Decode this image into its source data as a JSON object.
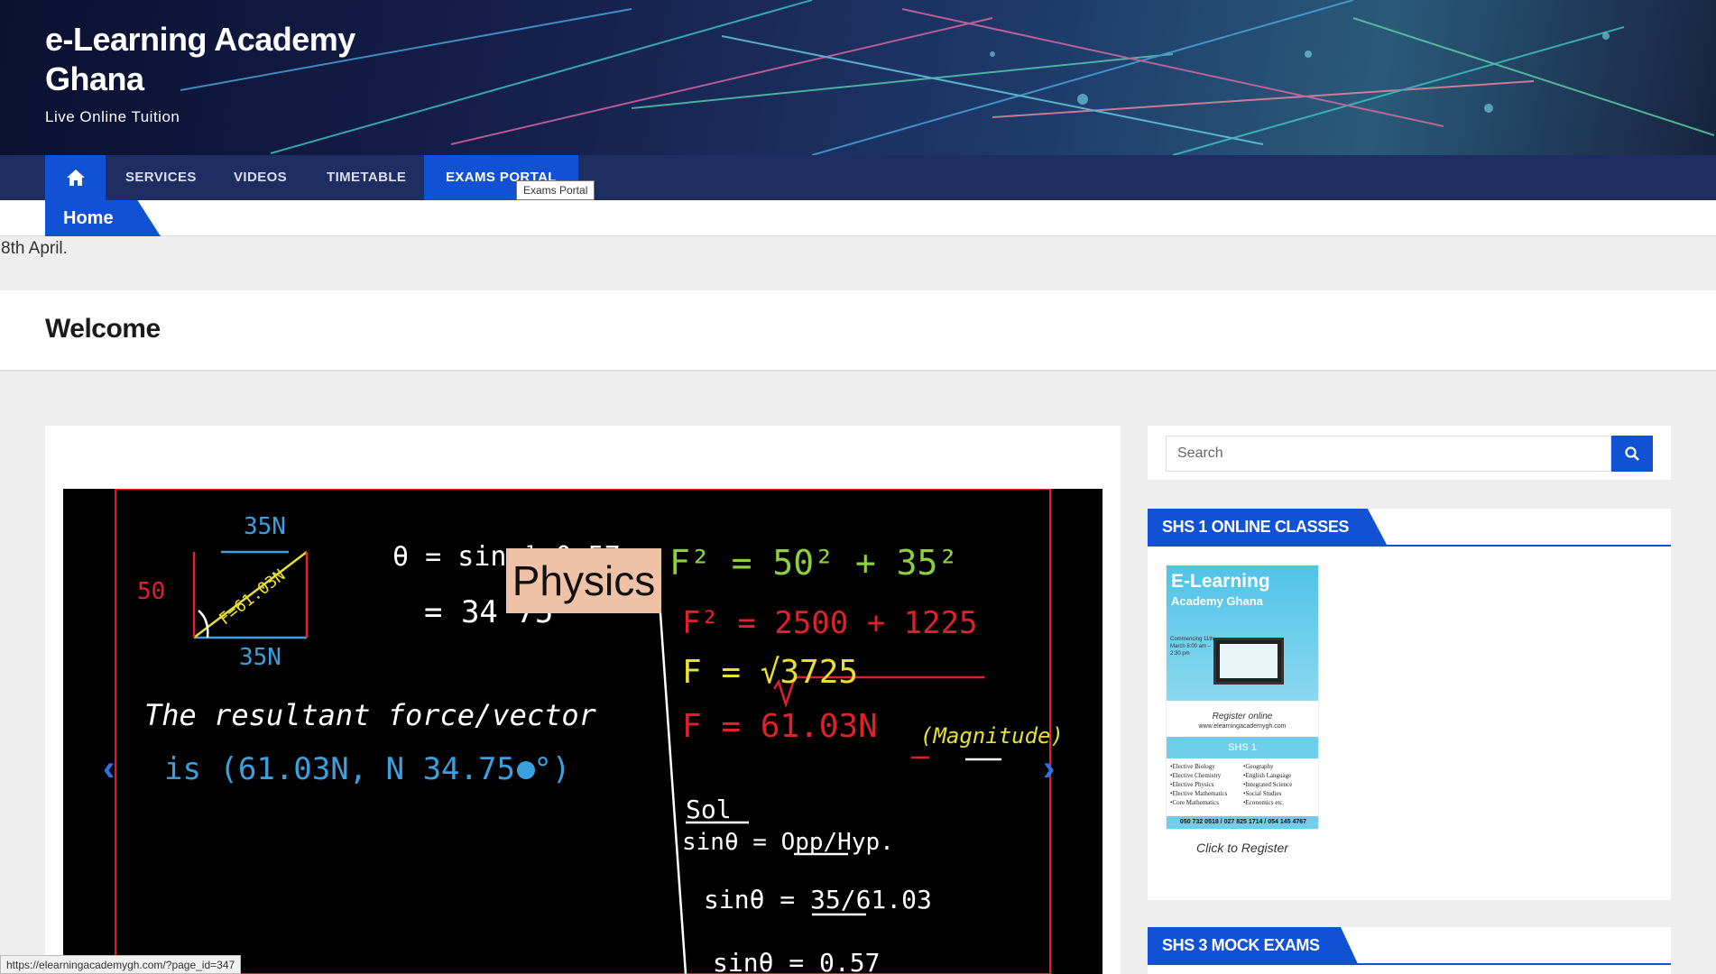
{
  "header": {
    "site_title": "e-Learning Academy Ghana",
    "tagline": "Live Online Tuition"
  },
  "nav": {
    "items": [
      {
        "label": "SERVICES"
      },
      {
        "label": "VIDEOS"
      },
      {
        "label": "TIMETABLE"
      },
      {
        "label": "EXAMS PORTAL"
      }
    ],
    "tooltip": "Exams Portal"
  },
  "breadcrumb": {
    "label": "Home"
  },
  "notice": "8th April.",
  "page": {
    "title": "Welcome"
  },
  "slider": {
    "label": "Physics",
    "board": {
      "t1": "35N",
      "t2": "50",
      "t3": "F=61.03N",
      "t4": "35N",
      "t5": "θ = sin⁻¹ 0.57",
      "t6": "= 34 75",
      "t7": "F² = 50² + 35²",
      "t8": "F² = 2500 + 1225",
      "t9": "F = √3725",
      "t10": "F = 61.03N",
      "t11": "(Magnitude)",
      "t12": "The resultant force/vector",
      "t13": "is (61.03N, N 34.75 °)",
      "t14": "Sol",
      "t15": "sinθ = Opp/Hyp.",
      "t16": "sinθ = 35/61.03",
      "t17": "sinθ = 0.57"
    }
  },
  "sidebar": {
    "search_placeholder": "Search",
    "widget1": {
      "title": "SHS 1 ONLINE CLASSES",
      "poster": {
        "title": "E-Learning",
        "subtitle": "Academy Ghana",
        "commencing": "Commencing 11th March 8:00 am – 2:30 pm",
        "register": "Register online",
        "website": "www.elearningacademygh.com",
        "level": "SHS 1",
        "subjects_left": [
          "•Elective Biology",
          "•Elective Chemistry",
          "•Elective Physics",
          "•Elective Mathematics",
          "•Core Mathematics"
        ],
        "subjects_right": [
          "•Geography",
          "•English Language",
          "•Integrated Science",
          "•Social Studies",
          "•Economics  etc."
        ],
        "phone": "050 732 0518 / 027 825 1714 / 054 145 4767"
      },
      "caption": "Click to Register"
    },
    "widget2": {
      "title": "SHS 3 MOCK EXAMS"
    }
  },
  "status_bar": {
    "url": "https://elearningacademygh.com/?page_id=347"
  }
}
